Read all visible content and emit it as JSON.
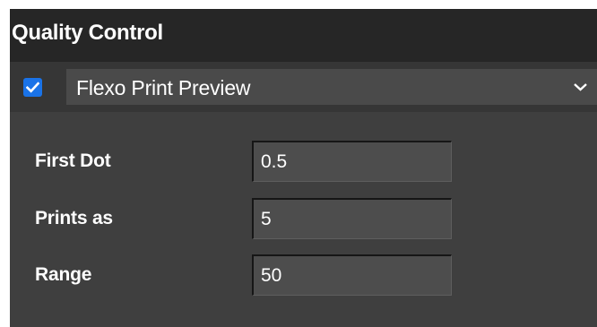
{
  "panel": {
    "title": "Quality Control",
    "mode": {
      "enabled": true,
      "selected": "Flexo Print Preview"
    },
    "fields": [
      {
        "label": "First Dot",
        "value": "0.5"
      },
      {
        "label": "Prints as",
        "value": "5"
      },
      {
        "label": "Range",
        "value": "50"
      }
    ]
  },
  "icons": {
    "checkbox": "checkmark-icon",
    "dropdown": "chevron-down-icon"
  },
  "colors": {
    "panel_bg": "#3f3f3f",
    "header_bg": "#262626",
    "accent": "#1a73e8",
    "text": "#ffffff"
  }
}
